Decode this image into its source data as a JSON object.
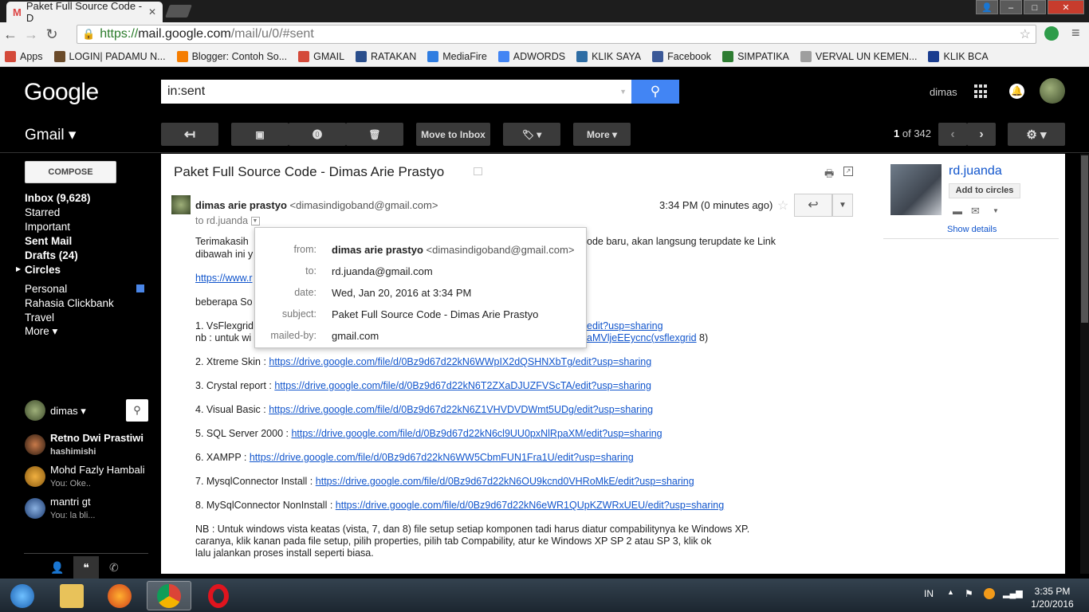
{
  "browser": {
    "tab_title": "Paket Full Source Code - D",
    "url_secure": "https://",
    "url_host": "mail.google.com",
    "url_path": "/mail/u/0/#sent",
    "bookmarks": [
      {
        "label": "Apps",
        "color": "#d44a3a"
      },
      {
        "label": "LOGIN| PADAMU N...",
        "color": "#6b4b2a"
      },
      {
        "label": "Blogger: Contoh So...",
        "color": "#f57d00"
      },
      {
        "label": "GMAIL",
        "color": "#d44a3a"
      },
      {
        "label": "RATAKAN",
        "color": "#2a4e8c"
      },
      {
        "label": "MediaFire",
        "color": "#2f7de1"
      },
      {
        "label": "ADWORDS",
        "color": "#4285f4"
      },
      {
        "label": "KLIK SAYA",
        "color": "#2e6da4"
      },
      {
        "label": "Facebook",
        "color": "#3b5998"
      },
      {
        "label": "SIMPATIKA",
        "color": "#2e7d32"
      },
      {
        "label": "VERVAL UN KEMEN...",
        "color": "#9e9e9e"
      },
      {
        "label": "KLIK BCA",
        "color": "#1a3d8f"
      }
    ]
  },
  "header": {
    "logo": "Google",
    "search_value": "in:sent",
    "user": "dimas"
  },
  "actions": {
    "app_title": "Gmail ▾",
    "move_to_inbox": "Move to Inbox",
    "more": "More ▾",
    "count_current": "1",
    "count_total": "of 342"
  },
  "sidebar": {
    "compose": "COMPOSE",
    "items": [
      {
        "label": "Inbox (9,628)"
      },
      {
        "label": "Starred"
      },
      {
        "label": "Important"
      },
      {
        "label": "Sent Mail"
      },
      {
        "label": "Drafts (24)"
      },
      {
        "label": "Circles"
      },
      {
        "label": "Personal"
      },
      {
        "label": "Rahasia Clickbank"
      },
      {
        "label": "Travel"
      },
      {
        "label": "More ▾"
      }
    ],
    "chat_user": "dimas",
    "chats": [
      {
        "name": "Retno Dwi Prastiwi",
        "sub": "hashimishi"
      },
      {
        "name": "Mohd Fazly Hambali",
        "sub": "You: Oke.."
      },
      {
        "name": "mantri gt",
        "sub": "You: la bli..."
      }
    ]
  },
  "email": {
    "subject": "Paket Full Source Code - Dimas Arie Prastyo",
    "sender_name": "dimas arie prastyo",
    "sender_email": "<dimasindigoband@gmail.com>",
    "to": "to rd.juanda",
    "time": "3:34 PM (0 minutes ago)",
    "body": {
      "intro1": "Terimakasih",
      "intro1_end": "ode baru, akan langsung terupdate ke Link",
      "intro2": "dibawah ini y",
      "link0": "https://www.r",
      "beberapa": "beberapa So",
      "l1a": "1. VsFlexgrid",
      "l1a_link": "edit?usp=sharing",
      "l1b": "nb : untuk wi",
      "l1b_link": "aMVljeEEycnc(vsflexgrid",
      "l1b_end": " 8)",
      "l2_label": "2. Xtreme Skin : ",
      "l2_link": "https://drive.google.com/file/d/0Bz9d67d22kN6WWpIX2dQSHNXbTg/edit?usp=sharing",
      "l3_label": "3. Crystal report : ",
      "l3_link": "https://drive.google.com/file/d/0Bz9d67d22kN6T2ZXaDJUZFVScTA/edit?usp=sharing",
      "l4_label": "4. Visual Basic : ",
      "l4_link": "https://drive.google.com/file/d/0Bz9d67d22kN6Z1VHVDVDWmt5UDg/edit?usp=sharing",
      "l5_label": "5. SQL Server 2000 : ",
      "l5_link": "https://drive.google.com/file/d/0Bz9d67d22kN6cl9UU0pxNlRpaXM/edit?usp=sharing",
      "l6_label": "6. XAMPP : ",
      "l6_link": "https://drive.google.com/file/d/0Bz9d67d22kN6WW5CbmFUN1Fra1U/edit?usp=sharing",
      "l7_label": "7. MysqlConnector Install : ",
      "l7_link": "https://drive.google.com/file/d/0Bz9d67d22kN6OU9kcnd0VHRoMkE/edit?usp=sharing",
      "l8_label": "8. MySqlConnector NonInstall : ",
      "l8_link": "https://drive.google.com/file/d/0Bz9d67d22kN6eWR1QUpKZWRxUEU/edit?usp=sharing",
      "nb1": "NB : Untuk windows vista keatas (vista, 7, dan 8) file setup setiap komponen tadi harus diatur compabilitynya ke Windows XP.",
      "nb2": "caranya, klik kanan pada file setup, pilih properties, pilih tab Compability, atur ke Windows XP SP 2 atau SP 3, klik ok",
      "nb3": "lalu jalankan proses install seperti biasa."
    },
    "details": {
      "from_label": "from:",
      "from_name": "dimas arie prastyo",
      "from_email": "<dimasindigoband@gmail.com>",
      "to_label": "to:",
      "to_value": "rd.juanda@gmail.com",
      "date_label": "date:",
      "date_value": "Wed, Jan 20, 2016 at 3:34 PM",
      "subject_label": "subject:",
      "subject_value": "Paket Full Source Code - Dimas Arie Prastyo",
      "mailedby_label": "mailed-by:",
      "mailedby_value": "gmail.com"
    }
  },
  "contact": {
    "name": "rd.juanda",
    "add_to_circles": "Add to circles",
    "show_details": "Show details"
  },
  "taskbar": {
    "lang": "IN",
    "time": "3:35 PM",
    "date": "1/20/2016"
  },
  "colors": {
    "accent": "#4285f4",
    "link": "#1155cc",
    "personal_label": "#4a86e8"
  }
}
